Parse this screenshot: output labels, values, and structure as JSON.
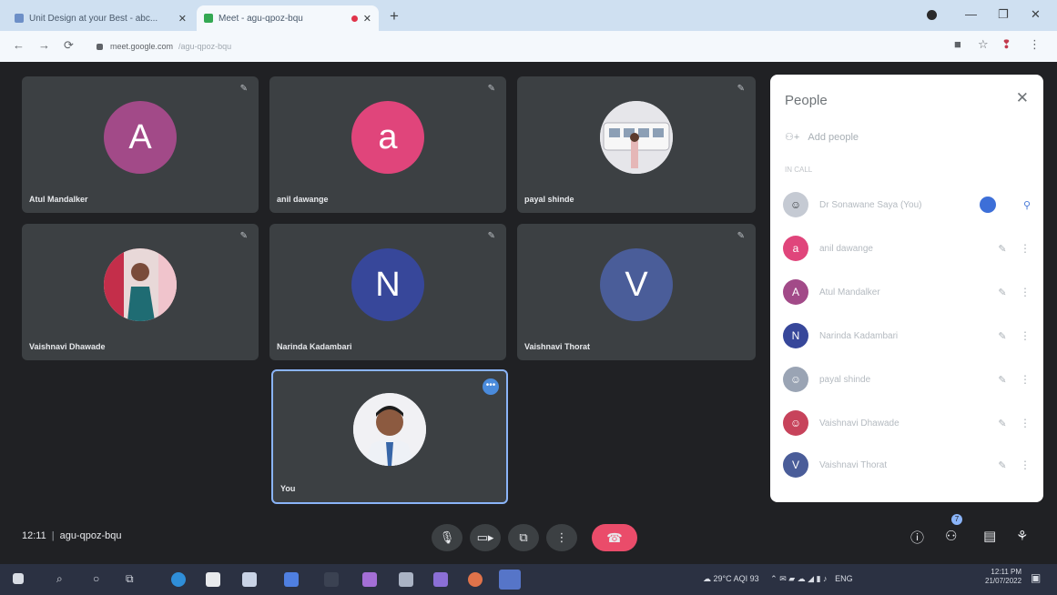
{
  "browser": {
    "tabs": [
      {
        "title": "Unit Design at your Best - abc..."
      },
      {
        "title": "Meet - agu-qpoz-bqu"
      }
    ],
    "url": "meet.google.com",
    "url_muted": "/agu-qpoz-bqu"
  },
  "meeting": {
    "time": "12:11",
    "code": "agu-qpoz-bqu",
    "participant_count": "7",
    "tiles": [
      {
        "name": "Atul Mandalker",
        "initial": "A",
        "color": "#a24a88"
      },
      {
        "name": "anil dawange",
        "initial": "a",
        "color": "#e0457b"
      },
      {
        "name": "payal shinde",
        "initial": "",
        "color": "#d7d7dd"
      },
      {
        "name": "Vaishnavi Dhawade",
        "initial": "",
        "color": "#c7435b"
      },
      {
        "name": "Narinda Kadambari",
        "initial": "N",
        "color": "#37479a"
      },
      {
        "name": "Vaishnavi Thorat",
        "initial": "V",
        "color": "#4a5d99"
      }
    ],
    "self": {
      "name": "You"
    }
  },
  "people_panel": {
    "title": "People",
    "add_people": "Add people",
    "section": "IN CALL",
    "members": [
      {
        "name": "Dr Sonawane Saya (You)",
        "initial": "",
        "color": "#c5cad3",
        "role": "host"
      },
      {
        "name": "anil dawange",
        "initial": "a",
        "color": "#e0457b"
      },
      {
        "name": "Atul Mandalker",
        "initial": "A",
        "color": "#a24a88"
      },
      {
        "name": "Narinda Kadambari",
        "initial": "N",
        "color": "#37479a"
      },
      {
        "name": "payal shinde",
        "initial": "",
        "color": "#9aa4b4"
      },
      {
        "name": "Vaishnavi Dhawade",
        "initial": "",
        "color": "#c7435b"
      },
      {
        "name": "Vaishnavi Thorat",
        "initial": "V",
        "color": "#4a5d99"
      }
    ]
  },
  "taskbar": {
    "weather": "29°C AQI 93",
    "lang": "ENG",
    "clock_time": "12:11 PM",
    "clock_date": "21/07/2022"
  },
  "colors": {
    "stage_bg": "#202124",
    "tile_bg": "#3c4043",
    "end_call": "#ea4c6a"
  }
}
